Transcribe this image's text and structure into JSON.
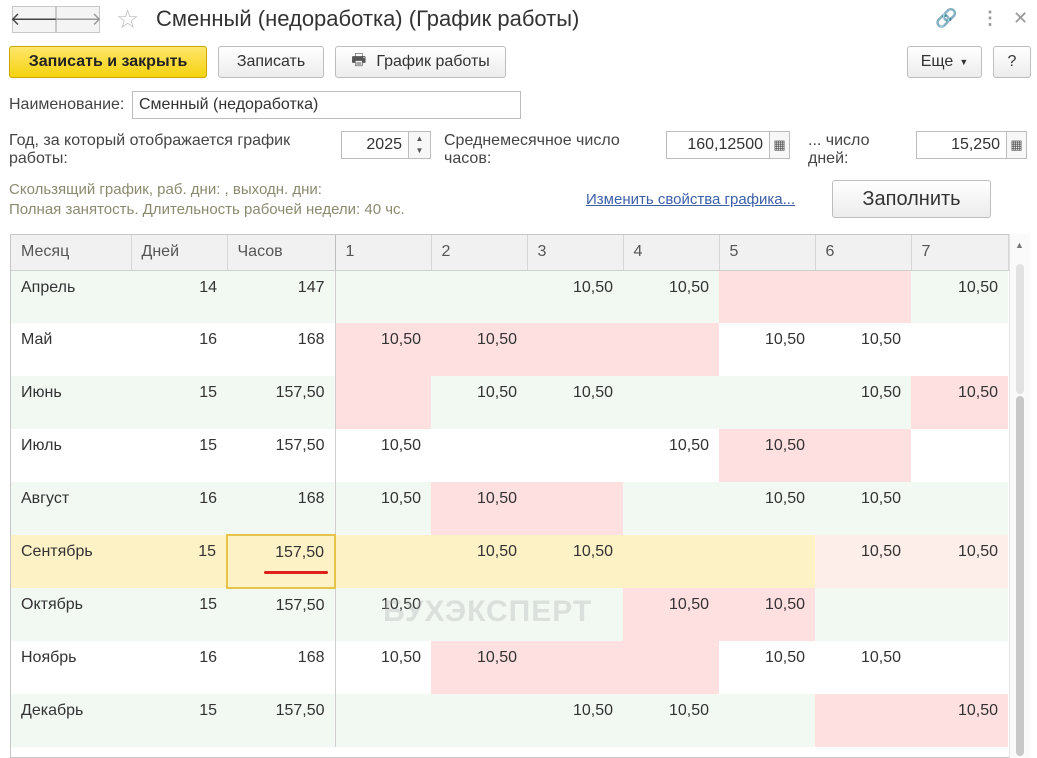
{
  "window": {
    "title": "Сменный (недоработка) (График работы)"
  },
  "toolbar": {
    "save_close": "Записать и закрыть",
    "save": "Записать",
    "schedule": "График работы",
    "more": "Еще",
    "help": "?"
  },
  "form": {
    "name_label": "Наименование:",
    "name_value": "Сменный (недоработка)",
    "year_label_1": "Год, за который отображается график",
    "year_label_2": "работы:",
    "year_value": "2025",
    "avg_hours_label_1": "Среднемесячное число",
    "avg_hours_label_2": "часов:",
    "avg_hours_value": "160,12500",
    "days_label_1": "... число",
    "days_label_2": "дней:",
    "days_value": "15,250",
    "info_line_1": "Скользящий график, раб. дни: , выходн. дни:",
    "info_line_2": "Полная занятость. Длительность рабочей недели: 40 чс.",
    "change_link": "Изменить свойства графика...",
    "fill_button": "Заполнить"
  },
  "table": {
    "headers": [
      "Месяц",
      "Дней",
      "Часов",
      "1",
      "2",
      "3",
      "4",
      "5",
      "6",
      "7"
    ],
    "rows": [
      {
        "month": "Апрель",
        "days": "14",
        "hours": "147",
        "d": [
          "",
          "",
          "10,50",
          "10,50",
          "",
          "",
          "10,50"
        ],
        "red": [
          0,
          0,
          0,
          0,
          1,
          1,
          0
        ]
      },
      {
        "month": "Май",
        "days": "16",
        "hours": "168",
        "d": [
          "10,50",
          "10,50",
          "",
          "",
          "10,50",
          "10,50",
          ""
        ],
        "red": [
          1,
          1,
          1,
          1,
          0,
          0,
          0
        ]
      },
      {
        "month": "Июнь",
        "days": "15",
        "hours": "157,50",
        "d": [
          "",
          "10,50",
          "10,50",
          "",
          "",
          "10,50",
          "10,50"
        ],
        "red": [
          1,
          0,
          0,
          0,
          0,
          0,
          1
        ]
      },
      {
        "month": "Июль",
        "days": "15",
        "hours": "157,50",
        "d": [
          "10,50",
          "",
          "",
          "10,50",
          "10,50",
          "",
          ""
        ],
        "red": [
          0,
          0,
          0,
          0,
          1,
          1,
          0
        ]
      },
      {
        "month": "Август",
        "days": "16",
        "hours": "168",
        "d": [
          "10,50",
          "10,50",
          "",
          "",
          "10,50",
          "10,50",
          ""
        ],
        "red": [
          0,
          1,
          1,
          0,
          0,
          0,
          0
        ]
      },
      {
        "month": "Сентябрь",
        "days": "15",
        "hours": "157,50",
        "d": [
          "",
          "10,50",
          "10,50",
          "",
          "",
          "10,50",
          "10,50"
        ],
        "red": [
          0,
          0,
          0,
          0,
          0,
          1,
          1
        ]
      },
      {
        "month": "Октябрь",
        "days": "15",
        "hours": "157,50",
        "d": [
          "10,50",
          "",
          "",
          "10,50",
          "10,50",
          "",
          ""
        ],
        "red": [
          0,
          0,
          0,
          1,
          1,
          0,
          0
        ]
      },
      {
        "month": "Ноябрь",
        "days": "16",
        "hours": "168",
        "d": [
          "10,50",
          "10,50",
          "",
          "",
          "10,50",
          "10,50",
          ""
        ],
        "red": [
          0,
          1,
          1,
          1,
          0,
          0,
          0
        ]
      },
      {
        "month": "Декабрь",
        "days": "15",
        "hours": "157,50",
        "d": [
          "",
          "",
          "10,50",
          "10,50",
          "",
          "",
          "10,50"
        ],
        "red": [
          0,
          0,
          0,
          0,
          0,
          1,
          1
        ]
      }
    ],
    "selected_row": 5
  },
  "watermark": "БУХЭКСПЕРТ"
}
